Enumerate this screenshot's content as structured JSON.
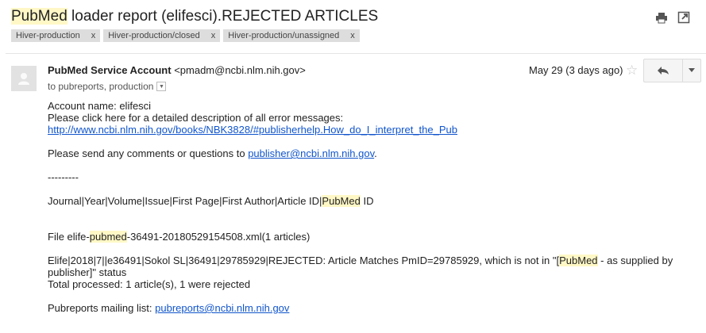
{
  "subject": {
    "highlight": "PubMed",
    "rest": " loader report (elifesci).REJECTED ARTICLES"
  },
  "labels": [
    {
      "text": "Hiver-production",
      "close": "x"
    },
    {
      "text": "Hiver-production/closed",
      "close": "x"
    },
    {
      "text": "Hiver-production/unassigned",
      "close": "x"
    }
  ],
  "message": {
    "sender_name": "PubMed Service Account",
    "sender_email": "<pmadm@ncbi.nlm.nih.gov>",
    "to": "to pubreports, production",
    "date": "May 29 (3 days ago)"
  },
  "body": {
    "account": "Account name: elifesci",
    "click_line": "Please click here for a detailed description of all error messages:",
    "help_link": "http://www.ncbi.nlm.nih.gov/books/NBK3828/#publisherhelp.How_do_I_interpret_the_Pub",
    "comments_prefix": "Please send any comments or questions to ",
    "comments_email": "publisher@ncbi.nlm.nih.gov",
    "comments_suffix": ".",
    "separator": "---------",
    "header_prefix": "Journal|Year|Volume|Issue|First Page|First Author|Article ID|",
    "header_highlight": "PubMed",
    "header_suffix": " ID",
    "file_prefix": "File elife-",
    "file_highlight": "pubmed",
    "file_suffix": "-36491-20180529154508.xml(1 articles)",
    "record_prefix": "Elife|2018|7||e36491|Sokol SL|36491|29785929|REJECTED: Article Matches PmID=29785929, which is not in \"[",
    "record_highlight": "PubMed",
    "record_suffix": " - as supplied by",
    "record_line2": "publisher]\" status",
    "total": "Total processed: 1 article(s), 1 were rejected",
    "mailing_prefix": "Pubreports mailing list: ",
    "mailing_email": "pubreports@ncbi.nlm.nih.gov"
  }
}
